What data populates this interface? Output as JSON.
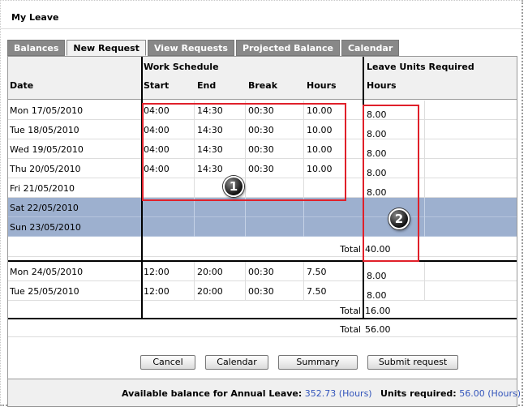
{
  "window": {
    "title": "My Leave"
  },
  "tabs": [
    "Balances",
    "New Request",
    "View Requests",
    "Projected Balance",
    "Calendar"
  ],
  "table": {
    "group_headers": {
      "work_schedule": "Work Schedule",
      "leave_units": "Leave Units Required"
    },
    "columns": {
      "date": "Date",
      "start": "Start",
      "end": "End",
      "break": "Break",
      "hours": "Hours",
      "leave_hours": "Hours"
    },
    "week1": [
      {
        "date": "Mon 17/05/2010",
        "start": "04:00",
        "end": "14:30",
        "break": "00:30",
        "hours": "10.00",
        "leave": "8.00",
        "weekend": false
      },
      {
        "date": "Tue 18/05/2010",
        "start": "04:00",
        "end": "14:30",
        "break": "00:30",
        "hours": "10.00",
        "leave": "8.00",
        "weekend": false
      },
      {
        "date": "Wed 19/05/2010",
        "start": "04:00",
        "end": "14:30",
        "break": "00:30",
        "hours": "10.00",
        "leave": "8.00",
        "weekend": false
      },
      {
        "date": "Thu 20/05/2010",
        "start": "04:00",
        "end": "14:30",
        "break": "00:30",
        "hours": "10.00",
        "leave": "8.00",
        "weekend": false
      },
      {
        "date": "Fri 21/05/2010",
        "start": "",
        "end": "",
        "break": "",
        "hours": "",
        "leave": "8.00",
        "weekend": false
      },
      {
        "date": "Sat 22/05/2010",
        "start": "",
        "end": "",
        "break": "",
        "hours": "",
        "leave": "",
        "weekend": true
      },
      {
        "date": "Sun 23/05/2010",
        "start": "",
        "end": "",
        "break": "",
        "hours": "",
        "leave": "",
        "weekend": true
      }
    ],
    "week1_total": {
      "label": "Total",
      "value": "40.00"
    },
    "week2": [
      {
        "date": "Mon 24/05/2010",
        "start": "12:00",
        "end": "20:00",
        "break": "00:30",
        "hours": "7.50",
        "leave": "8.00",
        "weekend": false
      },
      {
        "date": "Tue 25/05/2010",
        "start": "12:00",
        "end": "20:00",
        "break": "00:30",
        "hours": "7.50",
        "leave": "8.00",
        "weekend": false
      }
    ],
    "week2_total": {
      "label": "Total",
      "value": "16.00"
    },
    "grand_total": {
      "label": "Total",
      "value": "56.00"
    }
  },
  "buttons": {
    "cancel": "Cancel",
    "calendar": "Calendar",
    "summary": "Summary",
    "submit": "Submit request"
  },
  "footer": {
    "balance_label": "Available balance for Annual Leave:",
    "balance_value": "352.73 (Hours)",
    "units_label": "Units required:",
    "units_value": "56.00 (Hours)"
  },
  "callouts": {
    "one": "1",
    "two": "2"
  },
  "colors": {
    "weekend_row": "#9db0cf",
    "link_blue": "#3355bb",
    "annotation_red": "#e0202a"
  }
}
